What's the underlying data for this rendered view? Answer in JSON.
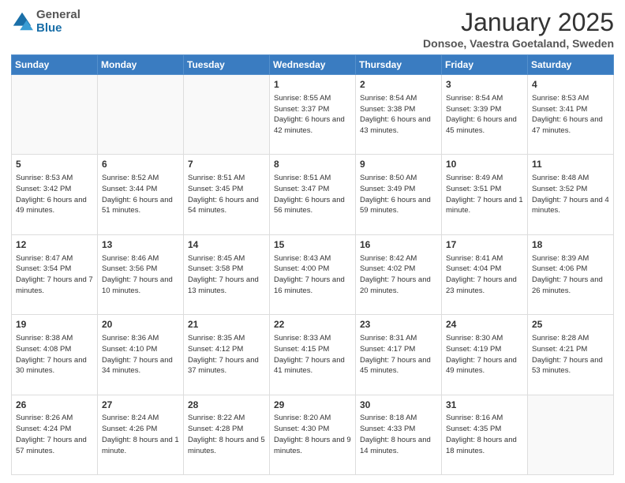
{
  "header": {
    "logo_general": "General",
    "logo_blue": "Blue",
    "month_title": "January 2025",
    "location": "Donsoe, Vaestra Goetaland, Sweden"
  },
  "days_of_week": [
    "Sunday",
    "Monday",
    "Tuesday",
    "Wednesday",
    "Thursday",
    "Friday",
    "Saturday"
  ],
  "weeks": [
    [
      {
        "day": "",
        "info": ""
      },
      {
        "day": "",
        "info": ""
      },
      {
        "day": "",
        "info": ""
      },
      {
        "day": "1",
        "info": "Sunrise: 8:55 AM\nSunset: 3:37 PM\nDaylight: 6 hours\nand 42 minutes."
      },
      {
        "day": "2",
        "info": "Sunrise: 8:54 AM\nSunset: 3:38 PM\nDaylight: 6 hours\nand 43 minutes."
      },
      {
        "day": "3",
        "info": "Sunrise: 8:54 AM\nSunset: 3:39 PM\nDaylight: 6 hours\nand 45 minutes."
      },
      {
        "day": "4",
        "info": "Sunrise: 8:53 AM\nSunset: 3:41 PM\nDaylight: 6 hours\nand 47 minutes."
      }
    ],
    [
      {
        "day": "5",
        "info": "Sunrise: 8:53 AM\nSunset: 3:42 PM\nDaylight: 6 hours\nand 49 minutes."
      },
      {
        "day": "6",
        "info": "Sunrise: 8:52 AM\nSunset: 3:44 PM\nDaylight: 6 hours\nand 51 minutes."
      },
      {
        "day": "7",
        "info": "Sunrise: 8:51 AM\nSunset: 3:45 PM\nDaylight: 6 hours\nand 54 minutes."
      },
      {
        "day": "8",
        "info": "Sunrise: 8:51 AM\nSunset: 3:47 PM\nDaylight: 6 hours\nand 56 minutes."
      },
      {
        "day": "9",
        "info": "Sunrise: 8:50 AM\nSunset: 3:49 PM\nDaylight: 6 hours\nand 59 minutes."
      },
      {
        "day": "10",
        "info": "Sunrise: 8:49 AM\nSunset: 3:51 PM\nDaylight: 7 hours\nand 1 minute."
      },
      {
        "day": "11",
        "info": "Sunrise: 8:48 AM\nSunset: 3:52 PM\nDaylight: 7 hours\nand 4 minutes."
      }
    ],
    [
      {
        "day": "12",
        "info": "Sunrise: 8:47 AM\nSunset: 3:54 PM\nDaylight: 7 hours\nand 7 minutes."
      },
      {
        "day": "13",
        "info": "Sunrise: 8:46 AM\nSunset: 3:56 PM\nDaylight: 7 hours\nand 10 minutes."
      },
      {
        "day": "14",
        "info": "Sunrise: 8:45 AM\nSunset: 3:58 PM\nDaylight: 7 hours\nand 13 minutes."
      },
      {
        "day": "15",
        "info": "Sunrise: 8:43 AM\nSunset: 4:00 PM\nDaylight: 7 hours\nand 16 minutes."
      },
      {
        "day": "16",
        "info": "Sunrise: 8:42 AM\nSunset: 4:02 PM\nDaylight: 7 hours\nand 20 minutes."
      },
      {
        "day": "17",
        "info": "Sunrise: 8:41 AM\nSunset: 4:04 PM\nDaylight: 7 hours\nand 23 minutes."
      },
      {
        "day": "18",
        "info": "Sunrise: 8:39 AM\nSunset: 4:06 PM\nDaylight: 7 hours\nand 26 minutes."
      }
    ],
    [
      {
        "day": "19",
        "info": "Sunrise: 8:38 AM\nSunset: 4:08 PM\nDaylight: 7 hours\nand 30 minutes."
      },
      {
        "day": "20",
        "info": "Sunrise: 8:36 AM\nSunset: 4:10 PM\nDaylight: 7 hours\nand 34 minutes."
      },
      {
        "day": "21",
        "info": "Sunrise: 8:35 AM\nSunset: 4:12 PM\nDaylight: 7 hours\nand 37 minutes."
      },
      {
        "day": "22",
        "info": "Sunrise: 8:33 AM\nSunset: 4:15 PM\nDaylight: 7 hours\nand 41 minutes."
      },
      {
        "day": "23",
        "info": "Sunrise: 8:31 AM\nSunset: 4:17 PM\nDaylight: 7 hours\nand 45 minutes."
      },
      {
        "day": "24",
        "info": "Sunrise: 8:30 AM\nSunset: 4:19 PM\nDaylight: 7 hours\nand 49 minutes."
      },
      {
        "day": "25",
        "info": "Sunrise: 8:28 AM\nSunset: 4:21 PM\nDaylight: 7 hours\nand 53 minutes."
      }
    ],
    [
      {
        "day": "26",
        "info": "Sunrise: 8:26 AM\nSunset: 4:24 PM\nDaylight: 7 hours\nand 57 minutes."
      },
      {
        "day": "27",
        "info": "Sunrise: 8:24 AM\nSunset: 4:26 PM\nDaylight: 8 hours\nand 1 minute."
      },
      {
        "day": "28",
        "info": "Sunrise: 8:22 AM\nSunset: 4:28 PM\nDaylight: 8 hours\nand 5 minutes."
      },
      {
        "day": "29",
        "info": "Sunrise: 8:20 AM\nSunset: 4:30 PM\nDaylight: 8 hours\nand 9 minutes."
      },
      {
        "day": "30",
        "info": "Sunrise: 8:18 AM\nSunset: 4:33 PM\nDaylight: 8 hours\nand 14 minutes."
      },
      {
        "day": "31",
        "info": "Sunrise: 8:16 AM\nSunset: 4:35 PM\nDaylight: 8 hours\nand 18 minutes."
      },
      {
        "day": "",
        "info": ""
      }
    ]
  ]
}
